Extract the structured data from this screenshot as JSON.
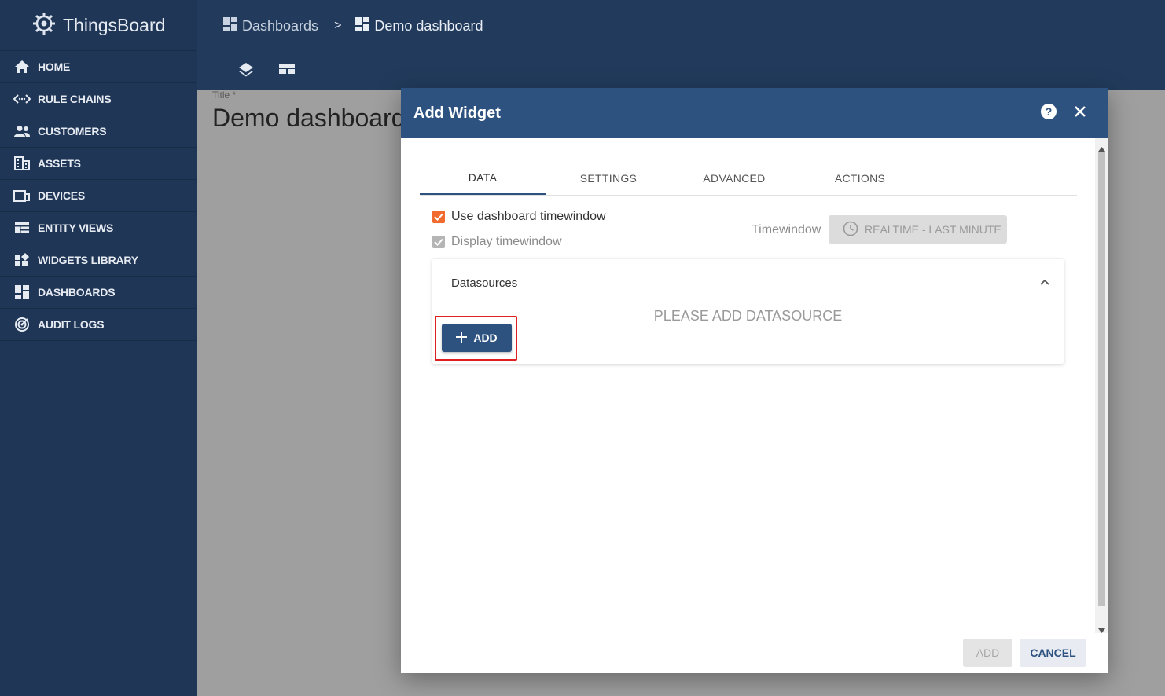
{
  "app": {
    "name": "ThingsBoard"
  },
  "sidebar": {
    "items": [
      {
        "label": "HOME",
        "icon": "home-icon"
      },
      {
        "label": "RULE CHAINS",
        "icon": "rule-chains-icon"
      },
      {
        "label": "CUSTOMERS",
        "icon": "customers-icon"
      },
      {
        "label": "ASSETS",
        "icon": "assets-icon"
      },
      {
        "label": "DEVICES",
        "icon": "devices-icon"
      },
      {
        "label": "ENTITY VIEWS",
        "icon": "entity-views-icon"
      },
      {
        "label": "WIDGETS LIBRARY",
        "icon": "widgets-library-icon"
      },
      {
        "label": "DASHBOARDS",
        "icon": "dashboards-icon"
      },
      {
        "label": "AUDIT LOGS",
        "icon": "audit-logs-icon"
      }
    ]
  },
  "header": {
    "breadcrumb": {
      "parent": "Dashboards",
      "separator": ">",
      "current": "Demo dashboard"
    }
  },
  "main": {
    "title_label": "Title *",
    "title_value": "Demo dashboard"
  },
  "dialog": {
    "title": "Add Widget",
    "tabs": [
      {
        "label": "DATA",
        "active": true
      },
      {
        "label": "SETTINGS",
        "active": false
      },
      {
        "label": "ADVANCED",
        "active": false
      },
      {
        "label": "ACTIONS",
        "active": false
      }
    ],
    "use_dashboard_timewindow": {
      "label": "Use dashboard timewindow",
      "checked": true
    },
    "display_timewindow": {
      "label": "Display timewindow",
      "checked": true
    },
    "timewindow": {
      "label": "Timewindow",
      "value": "REALTIME - LAST MINUTE"
    },
    "datasources": {
      "title": "Datasources",
      "empty_text": "PLEASE ADD DATASOURCE",
      "add_label": "ADD"
    },
    "footer": {
      "add_label": "ADD",
      "cancel_label": "CANCEL"
    }
  },
  "colors": {
    "sidebar": "#203656",
    "header": "#223b5c",
    "dialog_header": "#2e5280",
    "checkbox_accent": "#f26b2e",
    "highlight": "#e02020"
  }
}
